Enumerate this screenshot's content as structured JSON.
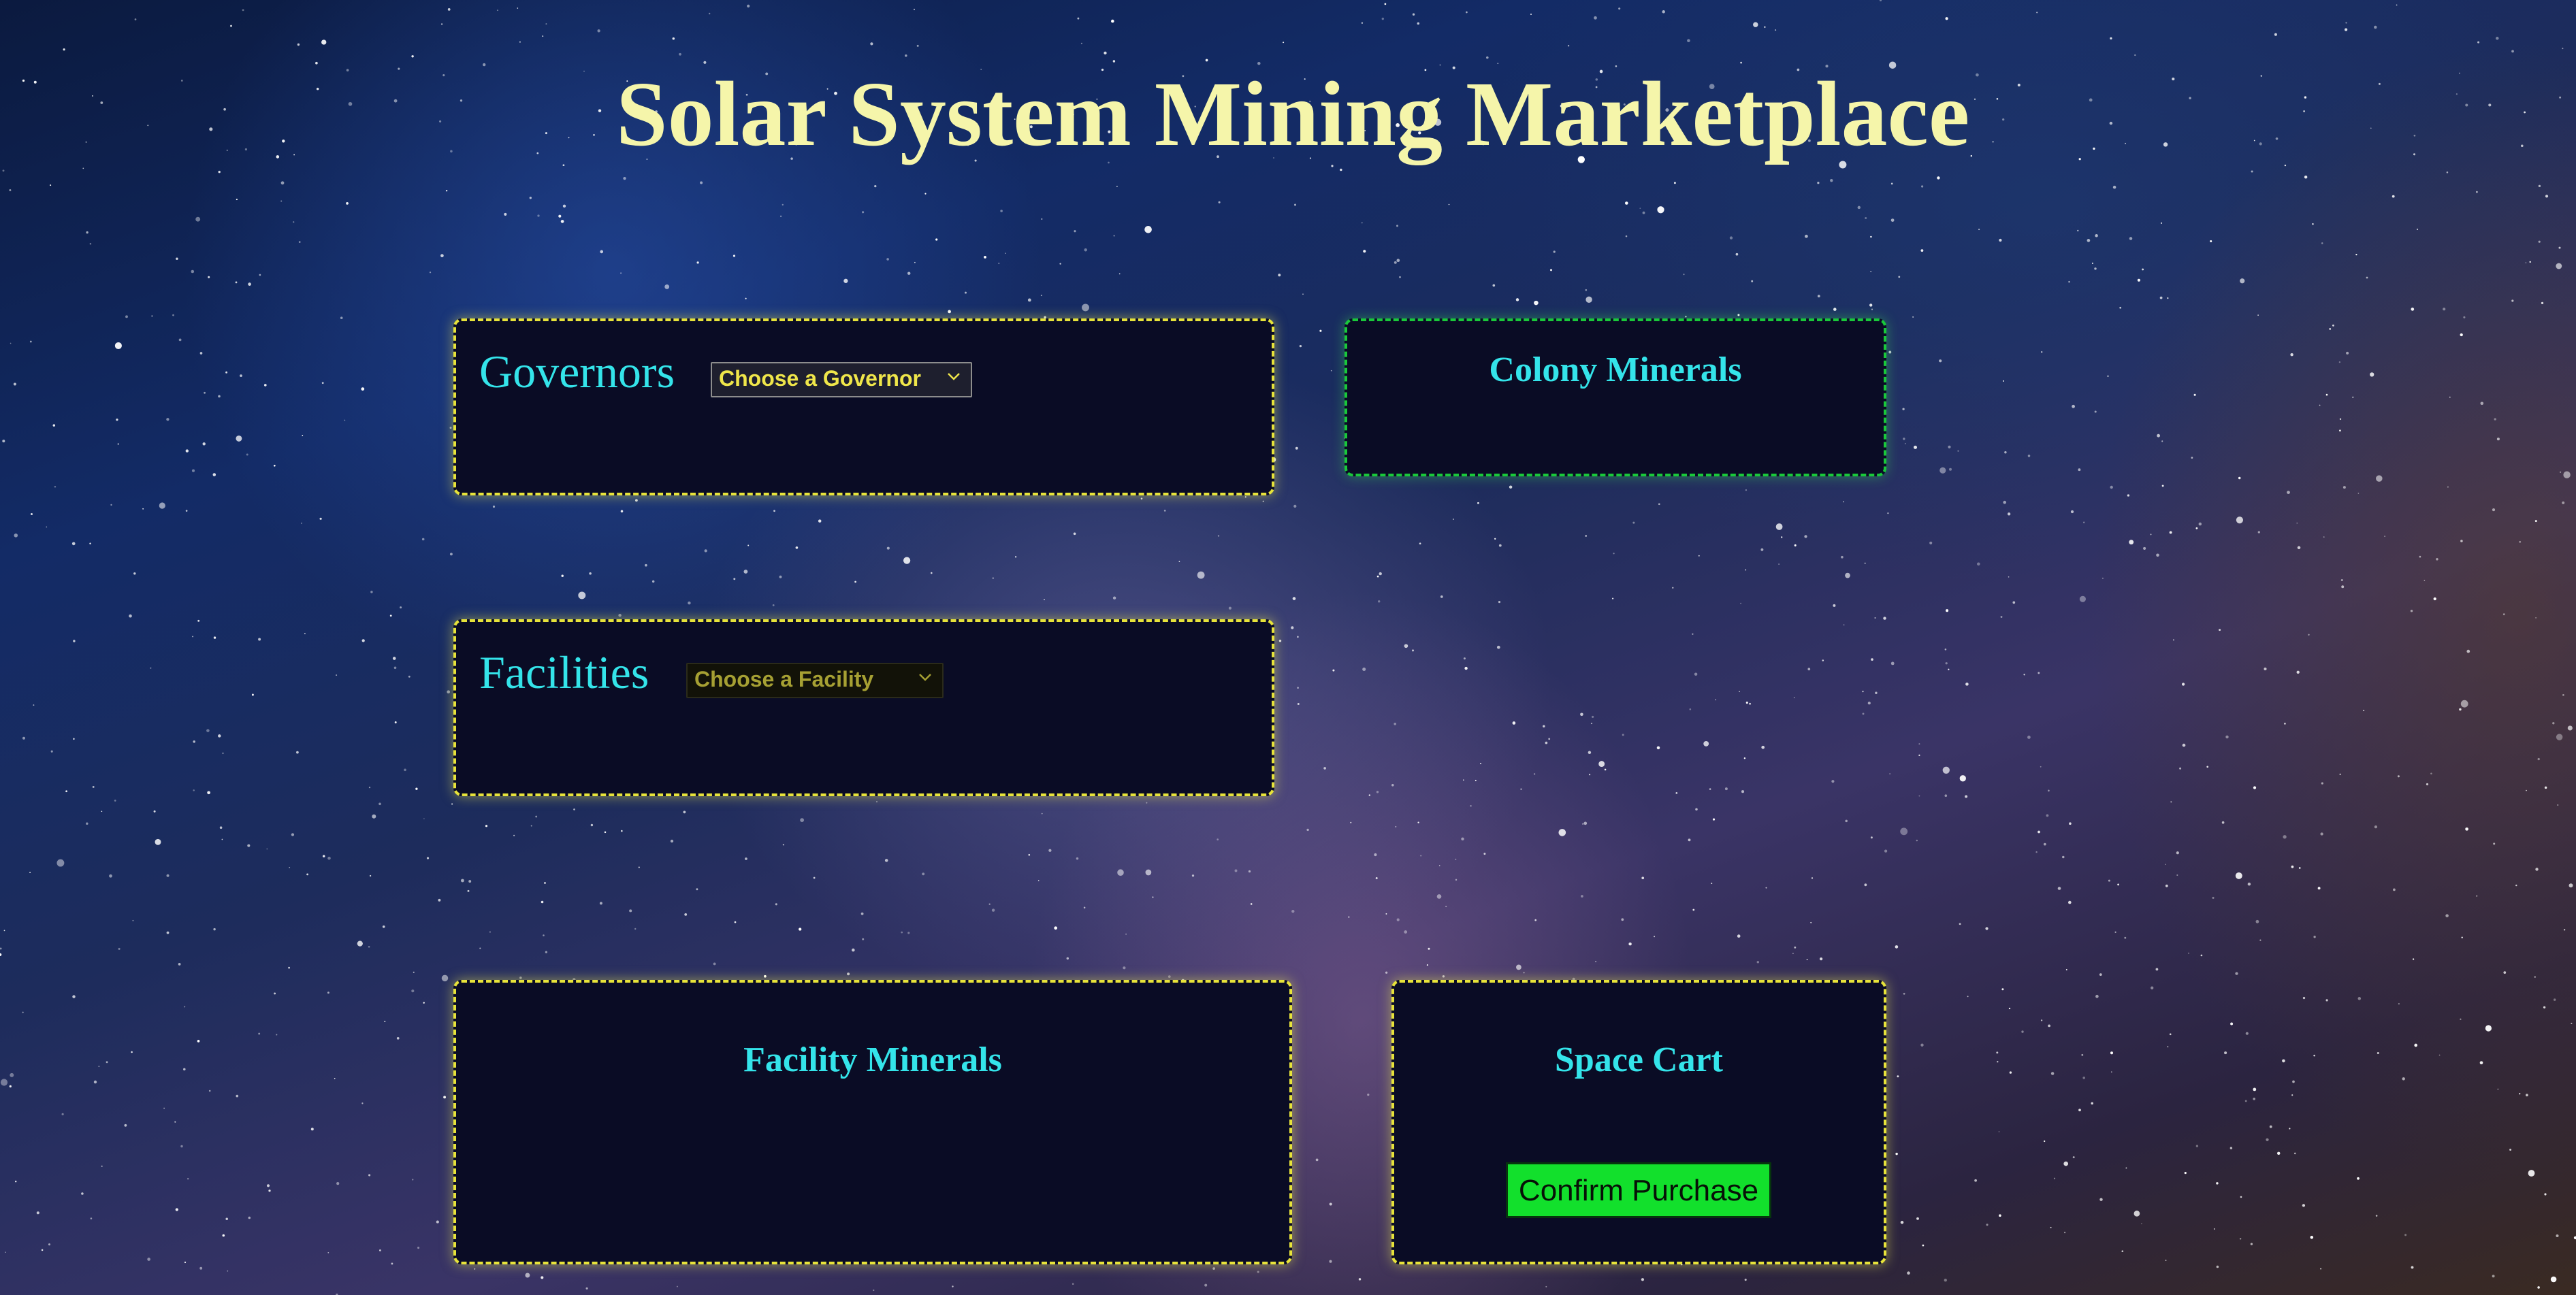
{
  "page": {
    "title": "Solar System Mining Marketplace"
  },
  "governors": {
    "label": "Governors",
    "select_value": "Choose a Governor",
    "dropdown_icon": "chevron-down-icon"
  },
  "facilities": {
    "label": "Facilities",
    "select_value": "Choose a Facility",
    "dropdown_icon": "chevron-down-icon"
  },
  "colony_minerals": {
    "heading": "Colony Minerals"
  },
  "facility_minerals": {
    "heading": "Facility Minerals"
  },
  "space_cart": {
    "heading": "Space Cart",
    "confirm_label": "Confirm Purchase"
  },
  "colors": {
    "title": "#f5f5aa",
    "label_cyan": "#34e4ea",
    "panel_background": "#0a0c25",
    "panel_border_yellow": "#e7e33a",
    "panel_border_green": "#19c93a",
    "confirm_button": "#12e02c"
  }
}
